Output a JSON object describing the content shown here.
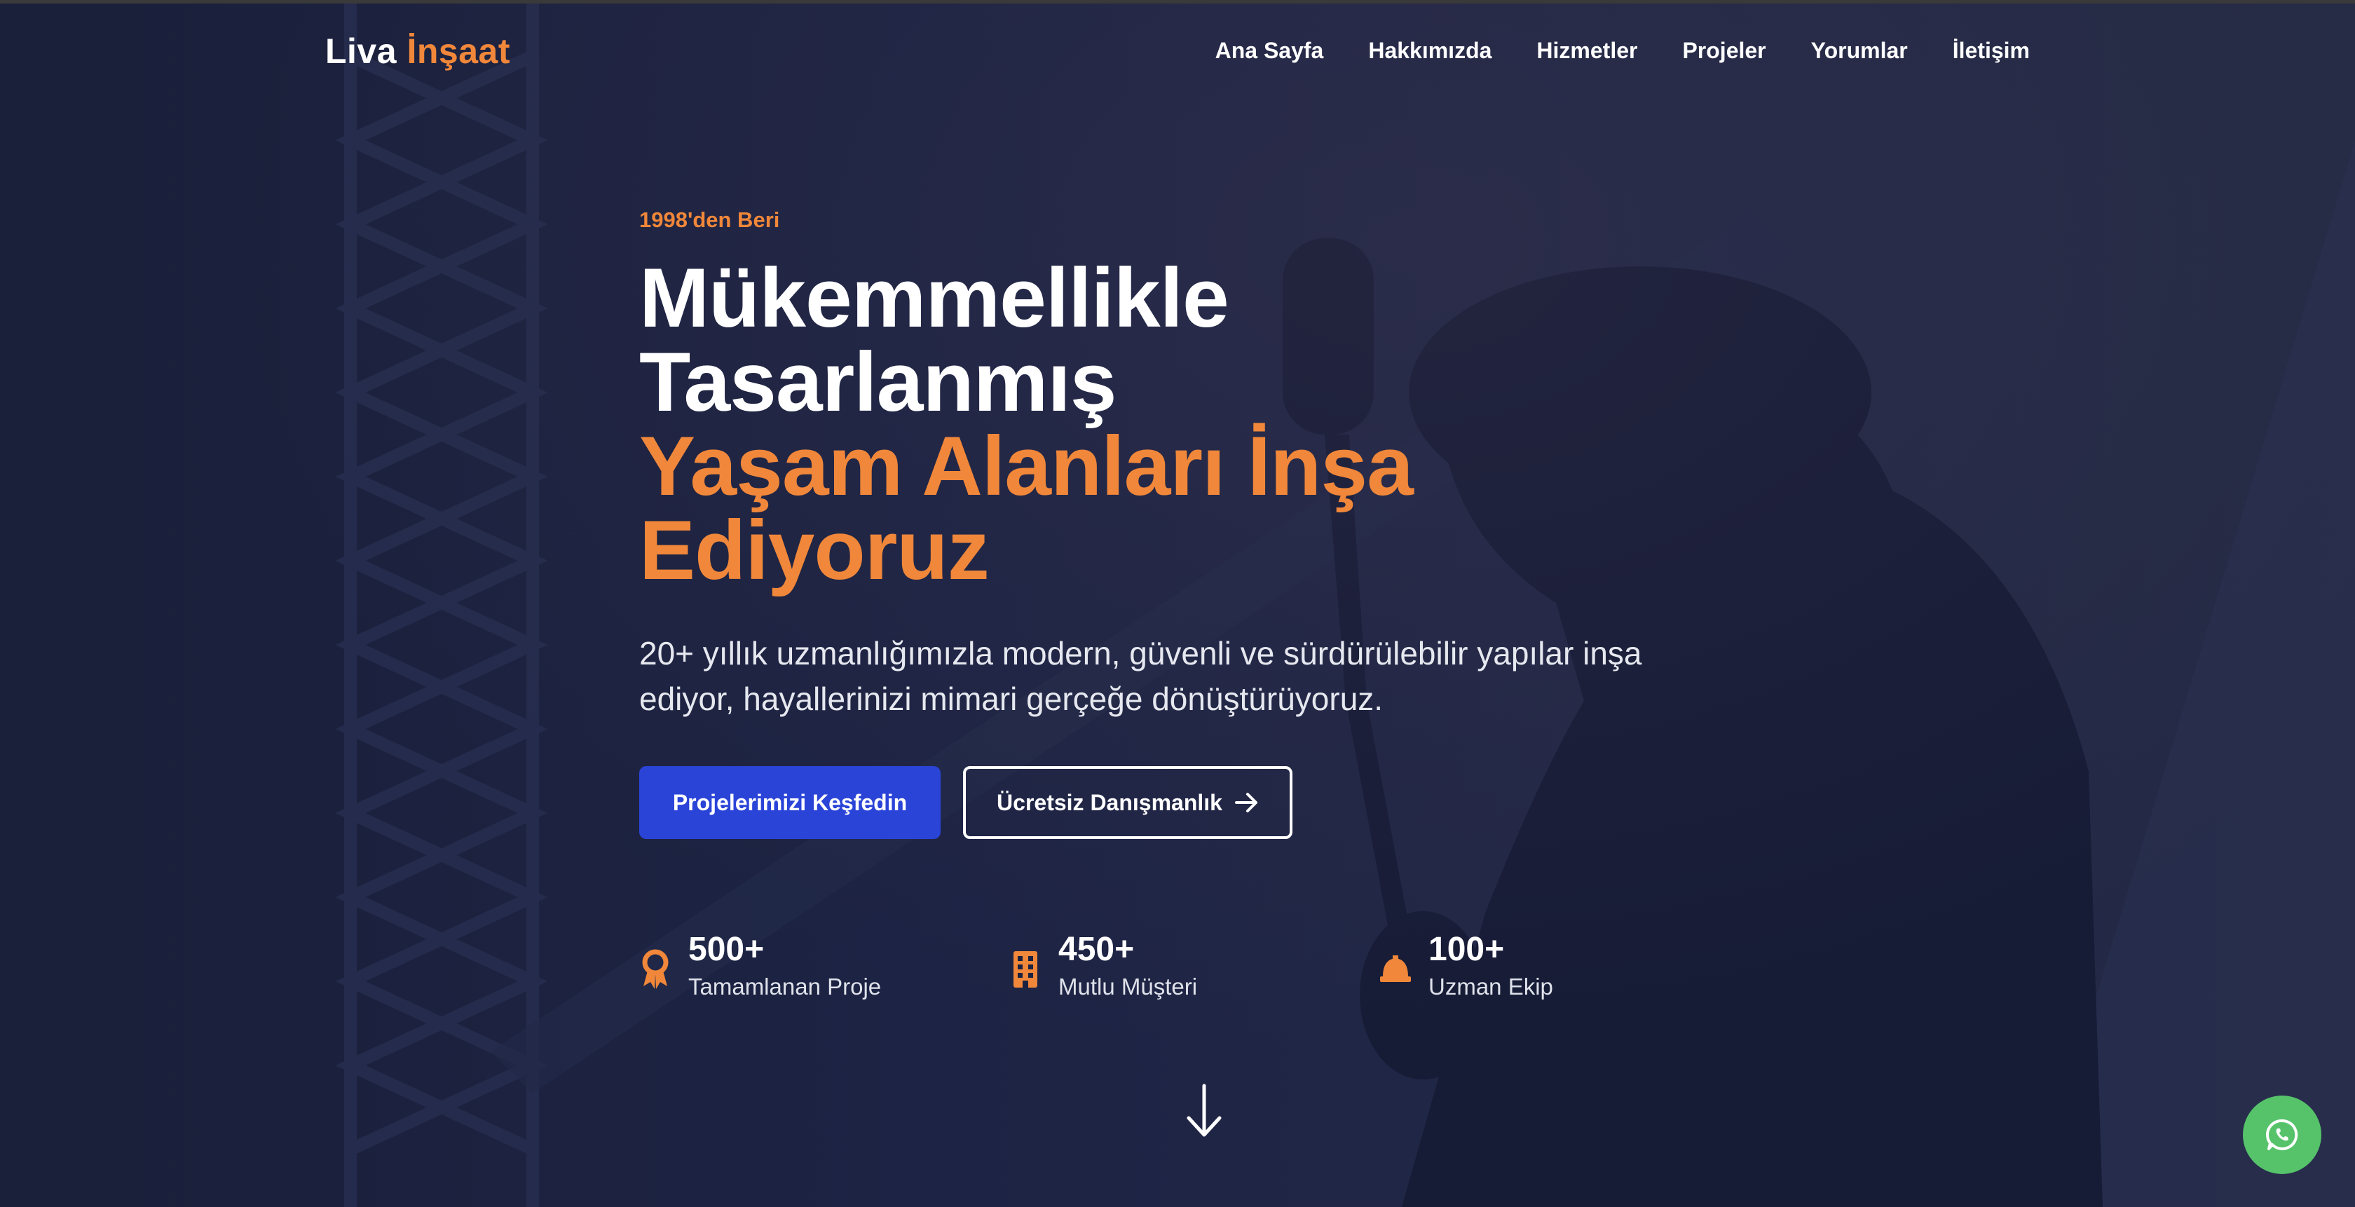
{
  "brand": {
    "name_part1": "Liva",
    "name_part2": "İnşaat"
  },
  "nav": {
    "items": [
      {
        "label": "Ana Sayfa"
      },
      {
        "label": "Hakkımızda"
      },
      {
        "label": "Hizmetler"
      },
      {
        "label": "Projeler"
      },
      {
        "label": "Yorumlar"
      },
      {
        "label": "İletişim"
      }
    ]
  },
  "hero": {
    "since": "1998'den Beri",
    "title_line1": "Mükemmellikle",
    "title_line2": "Tasarlanmış",
    "title_line3": "Yaşam Alanları İnşa",
    "title_line4": "Ediyoruz",
    "subtitle": "20+ yıllık uzmanlığımızla modern, güvenli ve sürdürülebilir yapılar inşa ediyor, hayallerinizi mimari gerçeğe dönüştürüyoruz.",
    "primary_button": "Projelerimizi Keşfedin",
    "secondary_button": "Ücretsiz Danışmanlık"
  },
  "stats": [
    {
      "value": "500+",
      "label": "Tamamlanan Proje",
      "icon": "award-icon"
    },
    {
      "value": "450+",
      "label": "Mutlu Müşteri",
      "icon": "building-icon"
    },
    {
      "value": "100+",
      "label": "Uzman Ekip",
      "icon": "hard-hat-icon"
    }
  ],
  "colors": {
    "accent": "#f0873a",
    "primary": "#2a44d8",
    "whatsapp": "#56c36a",
    "background": "#1b2140"
  },
  "icons": {
    "scroll": "arrow-down-icon",
    "chat": "whatsapp-icon",
    "button_arrow": "arrow-right-icon"
  }
}
